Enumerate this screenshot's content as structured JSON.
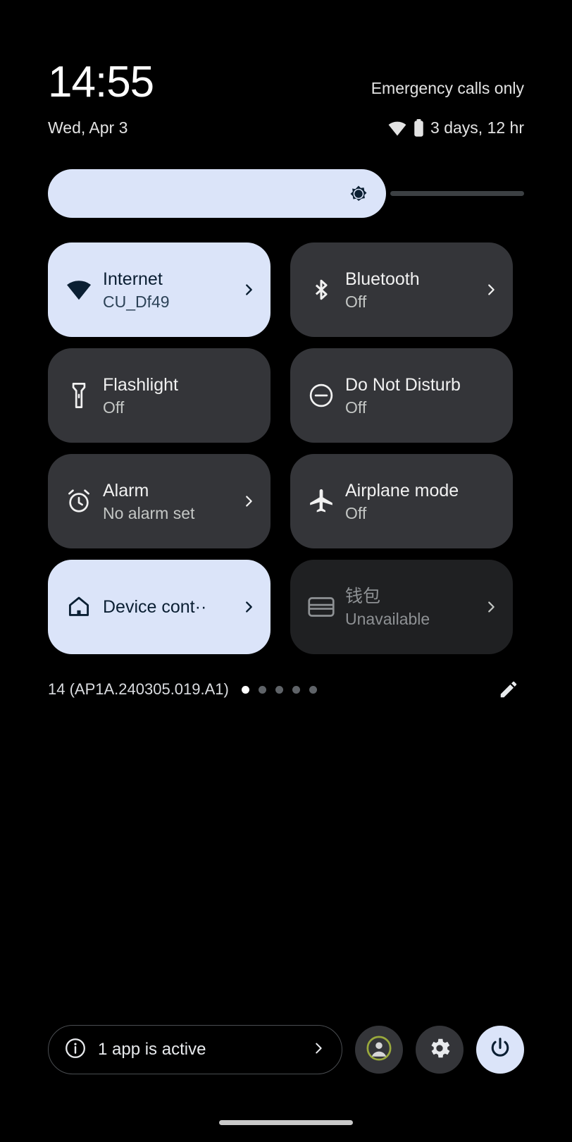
{
  "status": {
    "clock": "14:55",
    "carrier": "Emergency calls only",
    "date": "Wed, Apr 3",
    "battery_estimate": "3 days, 12 hr",
    "wifi_icon": "wifi-icon",
    "battery_icon": "battery-icon"
  },
  "brightness": {
    "icon": "brightness-sun-icon",
    "level_percent": 71,
    "label": "Brightness",
    "fill_color": "#dbe4f9",
    "track_color": "#3c4043"
  },
  "tiles": [
    {
      "name": "internet",
      "icon": "wifi-icon",
      "label": "Internet",
      "sub": "CU_Df49",
      "state": "active",
      "has_chevron": true
    },
    {
      "name": "bluetooth",
      "icon": "bluetooth-icon",
      "label": "Bluetooth",
      "sub": "Off",
      "state": "inactive",
      "has_chevron": true
    },
    {
      "name": "flashlight",
      "icon": "flashlight-icon",
      "label": "Flashlight",
      "sub": "Off",
      "state": "inactive",
      "has_chevron": false
    },
    {
      "name": "do-not-disturb",
      "icon": "do-not-disturb-icon",
      "label": "Do Not Disturb",
      "sub": "Off",
      "state": "inactive",
      "has_chevron": false
    },
    {
      "name": "alarm",
      "icon": "alarm-clock-icon",
      "label": "Alarm",
      "sub": "No alarm set",
      "state": "inactive",
      "has_chevron": true
    },
    {
      "name": "airplane-mode",
      "icon": "airplane-icon",
      "label": "Airplane mode",
      "sub": "Off",
      "state": "inactive",
      "has_chevron": false
    },
    {
      "name": "device-controls",
      "icon": "home-icon",
      "label": "Device cont··",
      "sub": "",
      "state": "active",
      "has_chevron": true
    },
    {
      "name": "wallet",
      "icon": "wallet-card-icon",
      "label": "钱包",
      "sub": "Unavailable",
      "state": "disabled",
      "has_chevron": true
    }
  ],
  "footer": {
    "build": "14 (AP1A.240305.019.A1)",
    "page_count": 5,
    "page_active_index": 0,
    "edit_icon": "pencil-edit-icon"
  },
  "bottom_bar": {
    "active_apps_label": "1 app is active",
    "info_icon": "info-icon",
    "chevron_icon": "chevron-right-icon",
    "user_icon": "user-avatar-icon",
    "settings_icon": "gear-icon",
    "power_icon": "power-icon",
    "accent_color": "#dbe4f9",
    "avatar_ring_color": "#9aaa3c"
  },
  "colors": {
    "background": "#000000",
    "tile_active": "#dbe4f9",
    "tile_inactive": "#343539",
    "tile_disabled": "#1f2022",
    "text_primary": "#f1f1f1",
    "text_on_active": "#0b1f33"
  }
}
